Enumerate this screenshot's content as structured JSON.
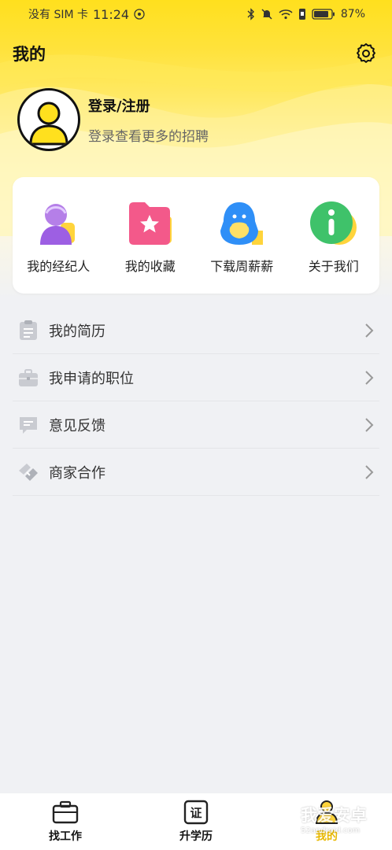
{
  "status_bar": {
    "carrier": "没有 SIM 卡",
    "time": "11:24",
    "battery": "87%"
  },
  "header": {
    "title": "我的",
    "settings_icon": "gear-icon"
  },
  "profile": {
    "login_label": "登录/注册",
    "subtitle": "登录查看更多的招聘"
  },
  "quick_links": [
    {
      "label": "我的经纪人",
      "icon": "agent-icon"
    },
    {
      "label": "我的收藏",
      "icon": "favorites-icon"
    },
    {
      "label": "下载周薪薪",
      "icon": "download-app-icon"
    },
    {
      "label": "关于我们",
      "icon": "info-icon"
    }
  ],
  "menu": [
    {
      "label": "我的简历",
      "icon": "resume-icon"
    },
    {
      "label": "我申请的职位",
      "icon": "briefcase-icon"
    },
    {
      "label": "意见反馈",
      "icon": "feedback-icon"
    },
    {
      "label": "商家合作",
      "icon": "handshake-icon"
    }
  ],
  "tabs": [
    {
      "label": "找工作",
      "icon": "job-icon"
    },
    {
      "label": "升学历",
      "icon": "certificate-icon",
      "icon_text": "证"
    },
    {
      "label": "我的",
      "icon": "profile-icon",
      "active": true
    }
  ],
  "watermark": {
    "main": "我爱安卓",
    "sub": "52android.com"
  },
  "colors": {
    "brand_yellow": "#ffe01e",
    "active_tab": "#e8b800",
    "background": "#f0f1f4"
  }
}
